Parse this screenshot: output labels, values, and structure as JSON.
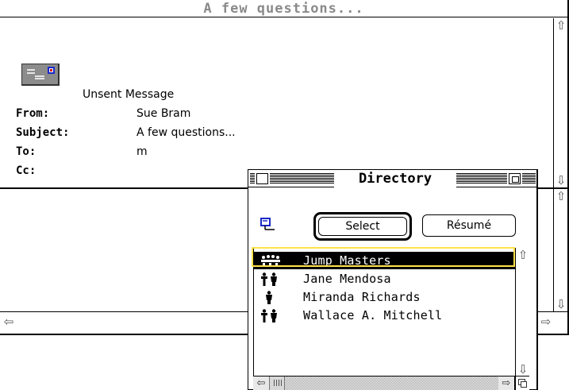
{
  "mail_window": {
    "title": "A few questions...",
    "status": "Unsent Message",
    "fields": [
      {
        "label": "From:",
        "value": "Sue Bram"
      },
      {
        "label": "Subject:",
        "value": "A few questions..."
      },
      {
        "label": "To:",
        "value": "m"
      },
      {
        "label": "Cc:",
        "value": ""
      }
    ]
  },
  "directory": {
    "title": "Directory",
    "select_label": "Select",
    "resume_label": "Résumé",
    "entries": [
      {
        "name": "Jump Masters",
        "icon": "group-icon",
        "selected": true
      },
      {
        "name": "Jane Mendosa",
        "icon": "couple-icon",
        "selected": false
      },
      {
        "name": "Miranda Richards",
        "icon": "person-icon",
        "selected": false
      },
      {
        "name": "Wallace A. Mitchell",
        "icon": "couple-icon",
        "selected": false
      }
    ]
  },
  "colors": {
    "title_gray": "#8a8a8a",
    "selection_outline": "#ffe24a",
    "stamp_blue": "#1a2ac8",
    "stamp_red": "#d01010"
  }
}
